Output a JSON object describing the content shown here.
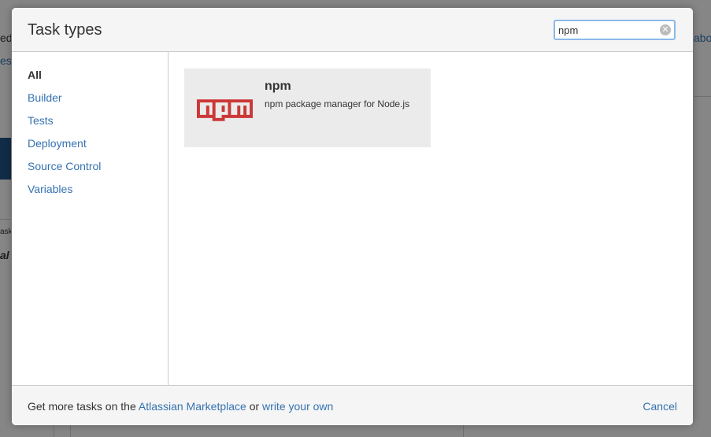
{
  "background": {
    "fragments": [
      "ed",
      "es",
      "ask",
      "al",
      "abou"
    ]
  },
  "dialog": {
    "title": "Task types",
    "search": {
      "value": "npm",
      "placeholder": ""
    }
  },
  "sidebar": {
    "items": [
      {
        "label": "All",
        "active": true
      },
      {
        "label": "Builder",
        "active": false
      },
      {
        "label": "Tests",
        "active": false
      },
      {
        "label": "Deployment",
        "active": false
      },
      {
        "label": "Source Control",
        "active": false
      },
      {
        "label": "Variables",
        "active": false
      }
    ]
  },
  "tasks": [
    {
      "name": "npm",
      "description": "npm package manager for Node.js",
      "icon": "npm-logo-icon"
    }
  ],
  "footer": {
    "prefix": "Get more tasks on the",
    "marketplace_link": "Atlassian Marketplace",
    "middle": "or",
    "write_link": "write your own",
    "cancel_label": "Cancel"
  },
  "colors": {
    "link": "#3572b0",
    "npm_red": "#cb3837",
    "card_bg": "#ebebeb",
    "header_bg": "#f5f5f5"
  }
}
